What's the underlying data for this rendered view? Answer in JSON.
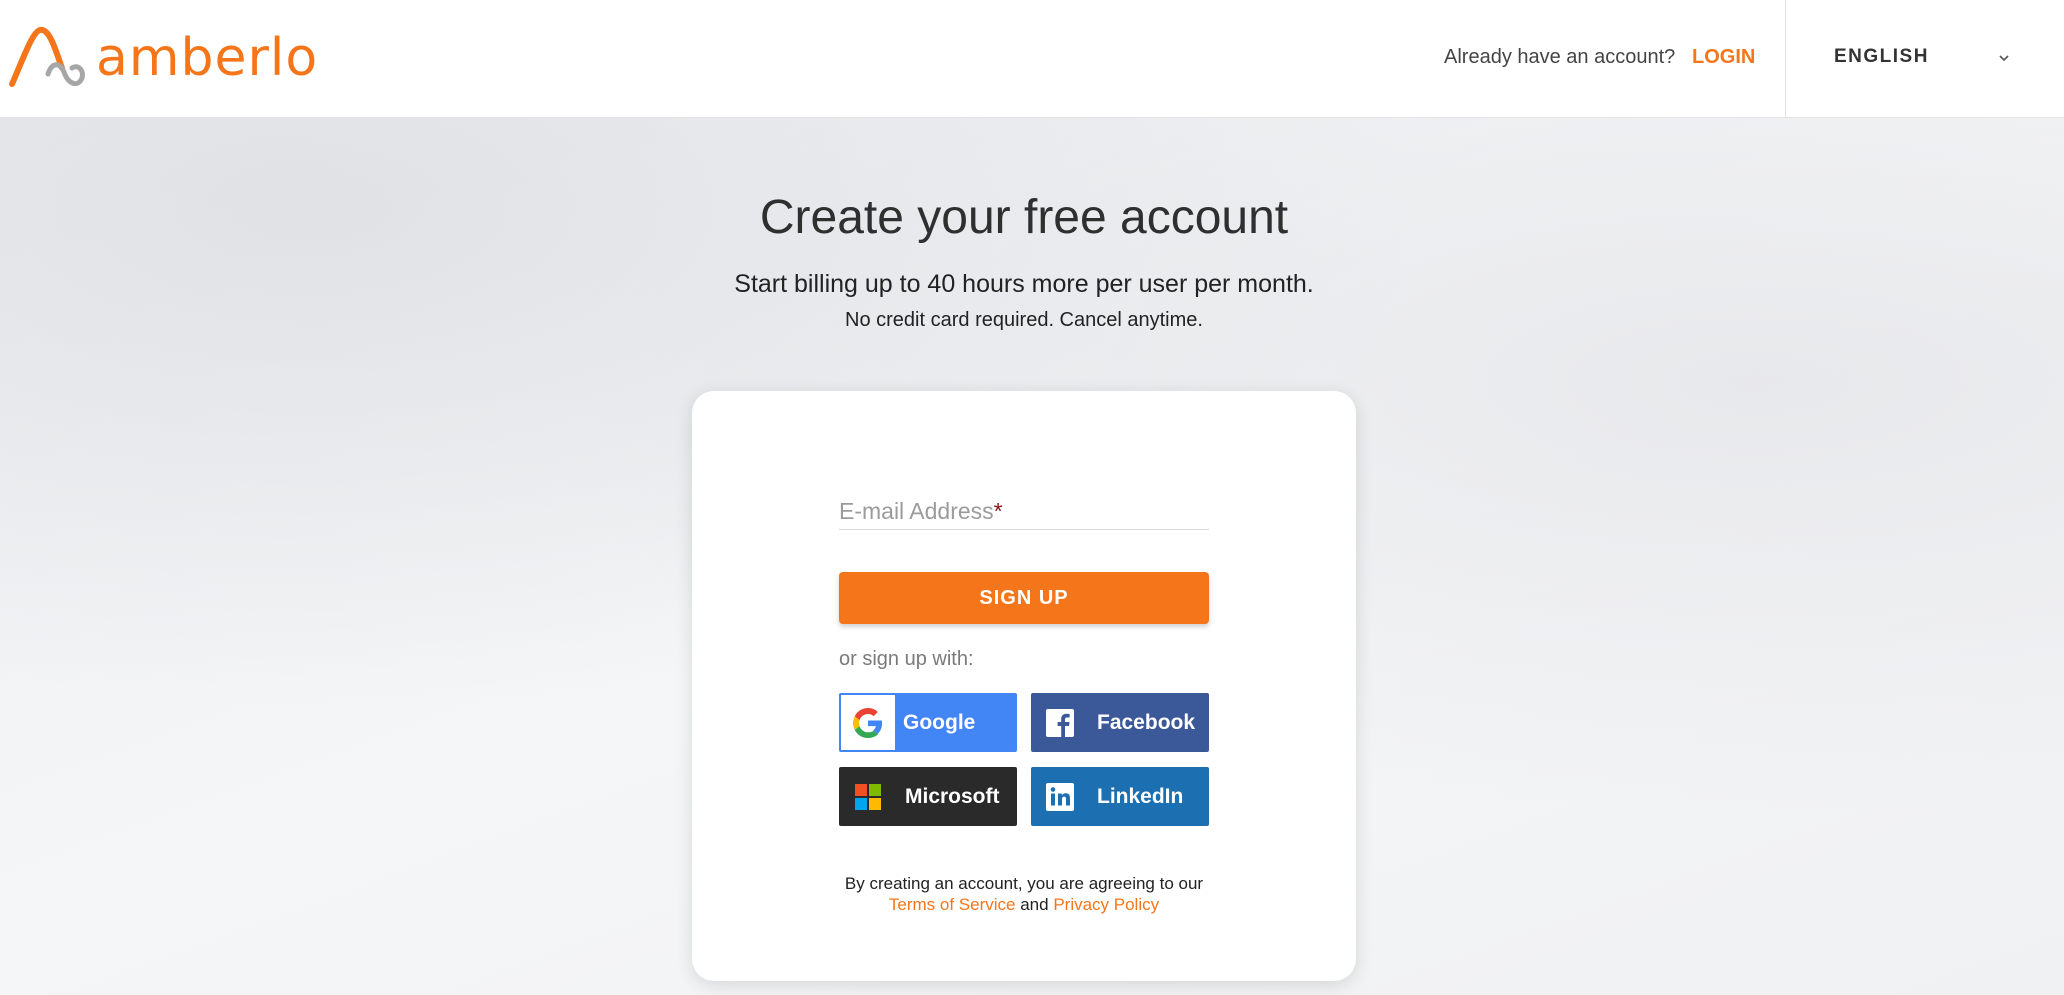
{
  "header": {
    "brand": "amberlo",
    "have_account": "Already have an account?",
    "login": "LOGIN",
    "language": "ENGLISH"
  },
  "hero": {
    "title": "Create your free account",
    "subtitle": "Start billing up to 40 hours more per user per month.",
    "note": "No credit card required. Cancel anytime."
  },
  "form": {
    "email_label": "E-mail Address",
    "required_mark": "*",
    "email_value": "",
    "signup_label": "SIGN UP",
    "or_text": "or sign up with:"
  },
  "social": {
    "google": "Google",
    "facebook": "Facebook",
    "microsoft": "Microsoft",
    "linkedin": "LinkedIn"
  },
  "terms": {
    "prefix": "By creating an account, you are agreeing to our",
    "tos": "Terms of Service",
    "and": "and",
    "privacy": "Privacy Policy"
  },
  "colors": {
    "accent": "#f5761a",
    "google": "#4285f4",
    "facebook": "#3b5998",
    "microsoft": "#2a2a2a",
    "linkedin": "#1c6fb0"
  }
}
